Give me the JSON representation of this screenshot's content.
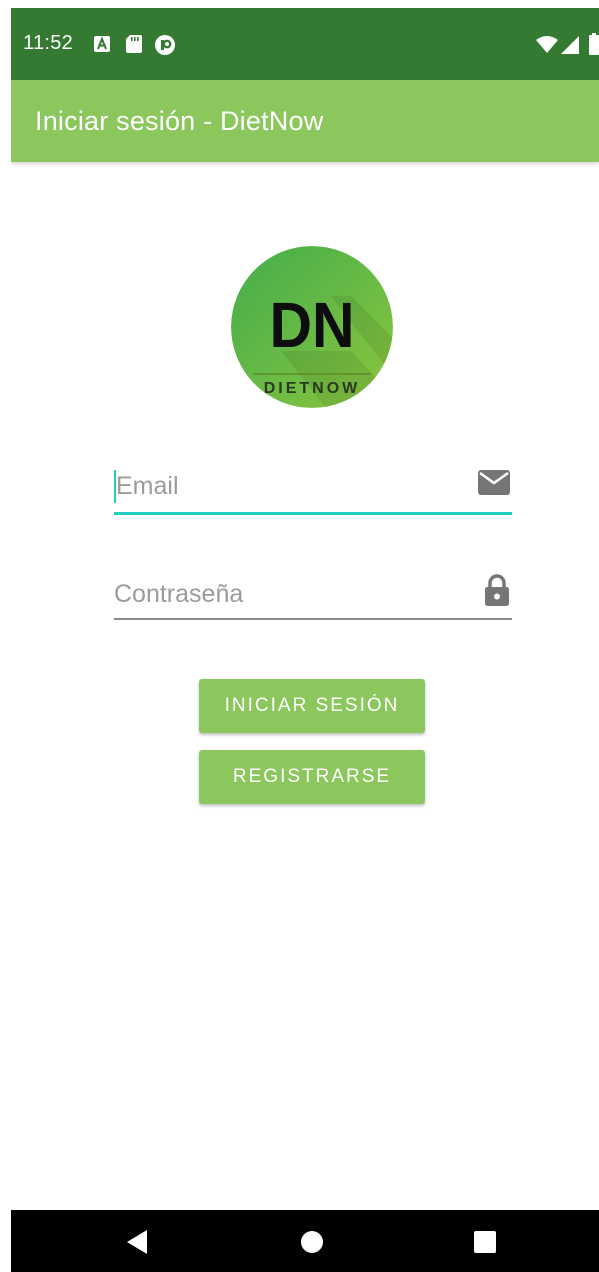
{
  "status_bar": {
    "time": "11:52",
    "left_icons": [
      "font-a-icon",
      "sd-card-icon",
      "sync-icon"
    ],
    "right_icons": [
      "wifi-icon",
      "signal-icon",
      "battery-icon"
    ]
  },
  "app_bar": {
    "title": "Iniciar sesión - DietNow"
  },
  "logo": {
    "initials": "DN",
    "brand": "DIETNOW"
  },
  "form": {
    "email": {
      "placeholder": "Email",
      "value": "",
      "icon": "email-icon"
    },
    "password": {
      "placeholder": "Contraseña",
      "value": "",
      "icon": "lock-icon"
    }
  },
  "buttons": {
    "login_label": "INICIAR SESIÓN",
    "register_label": "REGISTRARSE"
  },
  "navigation": {
    "icons": [
      "back-icon",
      "home-icon",
      "recents-icon"
    ]
  },
  "colors": {
    "status_bar": "#357a32",
    "primary": "#8bc75c",
    "accent": "#20cfc4",
    "icon_gray": "#757575"
  }
}
